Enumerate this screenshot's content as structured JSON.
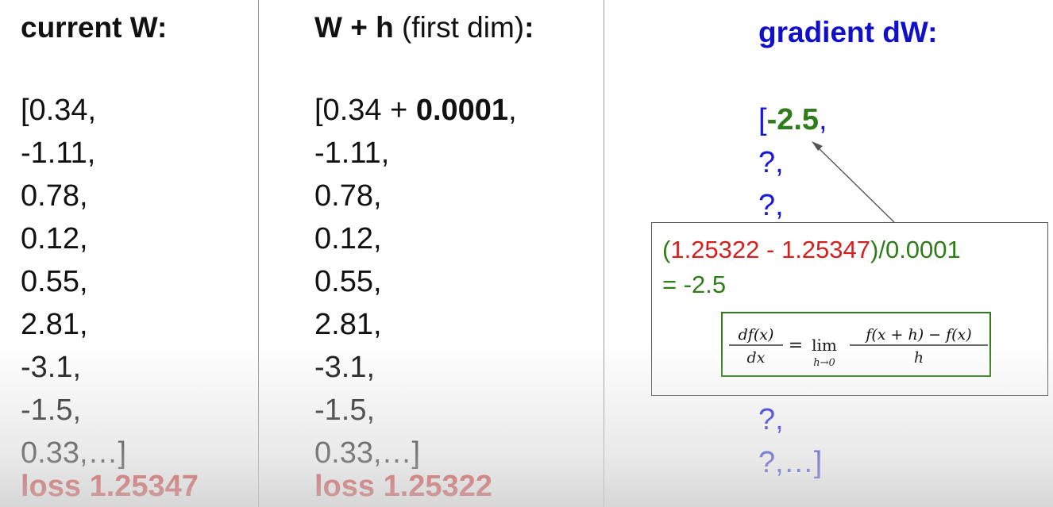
{
  "current_w": {
    "title": "current W:",
    "values": [
      "[0.34,",
      "-1.11,",
      "0.78,",
      "0.12,",
      "0.55,",
      "2.81,",
      "-3.1,",
      "-1.5,",
      "0.33,…]"
    ],
    "loss": "loss 1.25347"
  },
  "w_plus_h": {
    "title_bold": "W + h",
    "title_rest": "(first dim)",
    "title_colon": ":",
    "first_prefix": "[0.34 + ",
    "first_bold": "0.0001",
    "first_suffix": ",",
    "values": [
      "-1.11,",
      "0.78,",
      "0.12,",
      "0.55,",
      "2.81,",
      "-3.1,",
      "-1.5,",
      "0.33,…]"
    ],
    "loss": "loss 1.25322"
  },
  "gradient": {
    "title": "gradient dW:",
    "first_bracket": "[",
    "first_value": "-2.5",
    "first_comma": ",",
    "values": [
      "?,",
      "?,",
      "?,",
      "?,",
      "?,",
      "?,",
      "?,",
      "?,…]"
    ]
  },
  "callout": {
    "paren_open": "(",
    "loss_new": "1.25322",
    "minus": " - ",
    "loss_old": "1.25347",
    "rest": ")/0.0001",
    "result": "= -2.5",
    "formula": {
      "lhs_num": "df(x)",
      "lhs_den": "dx",
      "equals": "=",
      "lim": "lim",
      "lim_sub": "h→0",
      "rhs_num": "f(x + h) − f(x)",
      "rhs_den": "h"
    }
  },
  "colors": {
    "loss_red": "#cc0000",
    "gradient_blue": "#1010cc",
    "green": "#2e7d1a"
  }
}
